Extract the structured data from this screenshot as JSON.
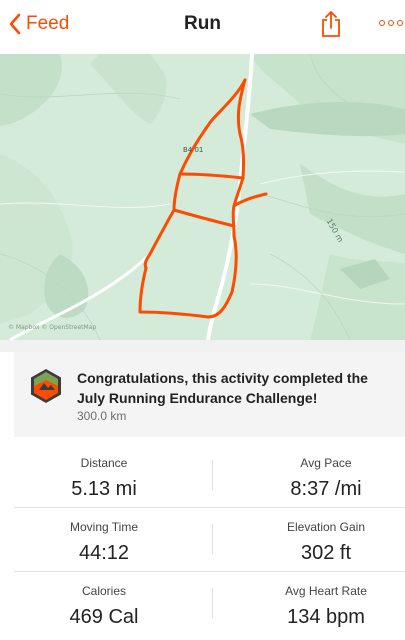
{
  "navbar": {
    "back_label": "Feed",
    "title": "Run",
    "share_icon": "share-icon",
    "more_icon": "more-icon",
    "accent_color": "#fc4c02"
  },
  "map": {
    "road_label": "B4 01",
    "contour_label": "150 m",
    "attribution": "© Mapbox © OpenStreetMap",
    "route_color": "#fc4c02"
  },
  "challenge": {
    "badge_icon": "challenge-badge-icon",
    "message": "Congratulations, this activity completed the July Running Endurance Challenge!",
    "distance": "300.0 km"
  },
  "stats": [
    {
      "left": {
        "label": "Distance",
        "value": "5.13 mi"
      },
      "right": {
        "label": "Avg Pace",
        "value": "8:37 /mi"
      }
    },
    {
      "left": {
        "label": "Moving Time",
        "value": "44:12"
      },
      "right": {
        "label": "Elevation Gain",
        "value": "302 ft"
      }
    },
    {
      "left": {
        "label": "Calories",
        "value": "469 Cal"
      },
      "right": {
        "label": "Avg Heart Rate",
        "value": "134 bpm"
      }
    }
  ]
}
